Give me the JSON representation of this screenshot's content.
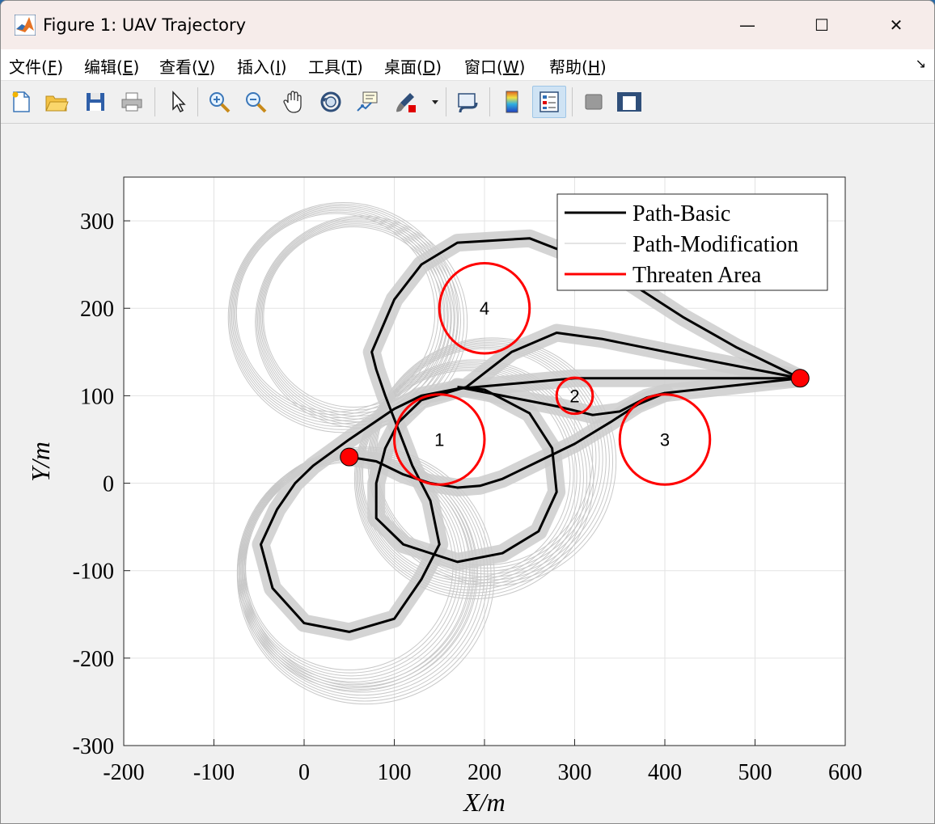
{
  "window": {
    "title": "Figure 1: UAV Trajectory",
    "minimize_glyph": "—",
    "maximize_glyph": "☐",
    "close_glyph": "✕"
  },
  "menu": {
    "items": [
      {
        "label": "文件(",
        "acc": "F",
        "end": ")"
      },
      {
        "label": "编辑(",
        "acc": "E",
        "end": ")"
      },
      {
        "label": "查看(",
        "acc": "V",
        "end": ")"
      },
      {
        "label": "插入(",
        "acc": "I",
        "end": ")"
      },
      {
        "label": "工具(",
        "acc": "T",
        "end": ")"
      },
      {
        "label": "桌面(",
        "acc": "D",
        "end": ")"
      },
      {
        "label": "窗口(",
        "acc": "W",
        "end": ")"
      },
      {
        "label": "帮助(",
        "acc": "H",
        "end": ")"
      }
    ],
    "more_glyph": "↘"
  },
  "toolbar": {
    "icons": [
      "new-figure-icon",
      "open-folder-icon",
      "save-icon",
      "print-icon",
      "select-arrow-icon",
      "zoom-in-icon",
      "zoom-out-icon",
      "pan-hand-icon",
      "rotate-3d-icon",
      "data-cursor-icon",
      "brush-icon",
      "brush-dropdown-icon",
      "link-plot-icon",
      "colorbar-icon",
      "legend-icon",
      "hide-plot-tools-icon",
      "show-plot-tools-icon"
    ]
  },
  "chart_data": {
    "type": "line",
    "xlabel": "X/m",
    "ylabel": "Y/m",
    "xlim": [
      -200,
      600
    ],
    "ylim": [
      -300,
      350
    ],
    "xticks": [
      "-200",
      "-100",
      "0",
      "100",
      "200",
      "300",
      "400",
      "500",
      "600"
    ],
    "yticks": [
      "-300",
      "-200",
      "-100",
      "0",
      "100",
      "200",
      "300"
    ],
    "grid": true,
    "legend": {
      "placement": "top-right",
      "entries": [
        {
          "name": "Path-Basic",
          "color": "#000000"
        },
        {
          "name": "Path-Modification",
          "color": "#c8c8c8"
        },
        {
          "name": "Threaten Area",
          "color": "#ff0000"
        }
      ]
    },
    "start_point": {
      "x": 50,
      "y": 30
    },
    "goal_point": {
      "x": 550,
      "y": 120
    },
    "threat_areas": [
      {
        "label": "1",
        "cx": 150,
        "cy": 50,
        "r": 50
      },
      {
        "label": "2",
        "cx": 300,
        "cy": 100,
        "r": 20
      },
      {
        "label": "3",
        "cx": 400,
        "cy": 50,
        "r": 50
      },
      {
        "label": "4",
        "cx": 200,
        "cy": 200,
        "r": 50
      }
    ],
    "series": [
      {
        "name": "Path-Basic",
        "paths": [
          [
            [
              50,
              30
            ],
            [
              80,
              25
            ],
            [
              110,
              10
            ],
            [
              140,
              0
            ],
            [
              170,
              -5
            ],
            [
              195,
              -3
            ],
            [
              220,
              5
            ],
            [
              260,
              25
            ],
            [
              300,
              45
            ],
            [
              340,
              70
            ],
            [
              370,
              90
            ],
            [
              400,
              103
            ],
            [
              550,
              120
            ]
          ],
          [
            [
              550,
              120
            ],
            [
              300,
              120
            ],
            [
              170,
              108
            ],
            [
              130,
              100
            ],
            [
              100,
              85
            ],
            [
              50,
              50
            ],
            [
              10,
              20
            ],
            [
              -10,
              0
            ],
            [
              -30,
              -30
            ],
            [
              -48,
              -70
            ],
            [
              -35,
              -120
            ],
            [
              0,
              -160
            ],
            [
              50,
              -170
            ],
            [
              100,
              -155
            ],
            [
              130,
              -110
            ],
            [
              150,
              -70
            ],
            [
              140,
              -20
            ],
            [
              120,
              20
            ],
            [
              105,
              60
            ],
            [
              90,
              100
            ],
            [
              80,
              130
            ],
            [
              75,
              150
            ],
            [
              100,
              210
            ],
            [
              130,
              250
            ],
            [
              170,
              275
            ],
            [
              250,
              280
            ],
            [
              300,
              260
            ],
            [
              360,
              230
            ],
            [
              420,
              190
            ],
            [
              480,
              155
            ],
            [
              550,
              120
            ]
          ],
          [
            [
              550,
              120
            ],
            [
              450,
              140
            ],
            [
              330,
              165
            ],
            [
              280,
              172
            ],
            [
              230,
              150
            ],
            [
              180,
              110
            ],
            [
              130,
              95
            ],
            [
              105,
              70
            ],
            [
              90,
              40
            ],
            [
              80,
              0
            ],
            [
              80,
              -40
            ],
            [
              110,
              -70
            ],
            [
              170,
              -90
            ],
            [
              220,
              -80
            ],
            [
              260,
              -55
            ],
            [
              280,
              -10
            ],
            [
              275,
              40
            ],
            [
              250,
              80
            ],
            [
              200,
              107
            ],
            [
              170,
              110
            ]
          ],
          [
            [
              170,
              110
            ],
            [
              220,
              100
            ],
            [
              280,
              88
            ],
            [
              320,
              78
            ],
            [
              350,
              82
            ],
            [
              380,
              98
            ],
            [
              400,
              103
            ]
          ]
        ]
      },
      {
        "name": "Path-Modification",
        "circles": [
          {
            "cx": 35,
            "cy": 195,
            "r": 110
          },
          {
            "cx": 55,
            "cy": 190,
            "r": 100
          },
          {
            "cx": 180,
            "cy": 10,
            "r": 115
          },
          {
            "cx": 200,
            "cy": 30,
            "r": 120
          },
          {
            "cx": 50,
            "cy": -95,
            "r": 115
          },
          {
            "cx": 60,
            "cy": -100,
            "r": 125
          }
        ]
      }
    ]
  }
}
